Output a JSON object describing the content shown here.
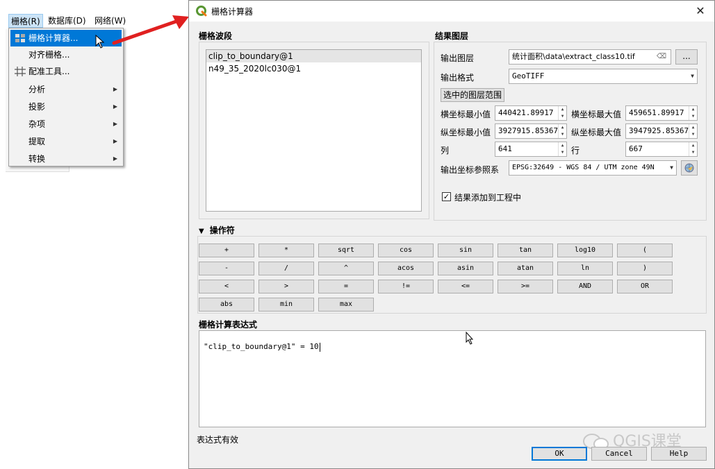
{
  "menubar": {
    "raster": "栅格(R)",
    "database": "数据库(D)",
    "web": "网络(W)"
  },
  "dropdown": {
    "items": [
      {
        "label": "栅格计算器...",
        "submenu": false
      },
      {
        "label": "对齐栅格...",
        "submenu": false
      },
      {
        "label": "配准工具...",
        "submenu": false
      },
      {
        "label": "分析",
        "submenu": true
      },
      {
        "label": "投影",
        "submenu": true
      },
      {
        "label": "杂项",
        "submenu": true
      },
      {
        "label": "提取",
        "submenu": true
      },
      {
        "label": "转换",
        "submenu": true
      }
    ]
  },
  "dialog": {
    "title": "栅格计算器",
    "bands_title": "栅格波段",
    "bands": [
      "clip_to_boundary@1",
      "n49_35_2020lc030@1"
    ],
    "result_title": "结果图层",
    "output_layer_label": "输出图层",
    "output_layer_value": "统计面积\\data\\extract_class10.tif",
    "browse_label": "...",
    "output_format_label": "输出格式",
    "output_format_value": "GeoTIFF",
    "selected_extent_btn": "选中的图层范围",
    "xmin_label": "横坐标最小值",
    "xmin": "440421.89917",
    "xmax_label": "横坐标最大值",
    "xmax": "459651.89917",
    "ymin_label": "纵坐标最小值",
    "ymin": "3927915.85367",
    "ymax_label": "纵坐标最大值",
    "ymax": "3947925.85367",
    "cols_label": "列",
    "cols": "641",
    "rows_label": "行",
    "rows": "667",
    "crs_label": "输出坐标参照系",
    "crs_value": "EPSG:32649 - WGS 84 / UTM zone 49N",
    "add_to_project_label": "结果添加到工程中",
    "operators_title": "操作符",
    "operators": [
      "+",
      "*",
      "sqrt",
      "cos",
      "sin",
      "tan",
      "log10",
      "(",
      "-",
      "/",
      "^",
      "acos",
      "asin",
      "atan",
      "ln",
      ")",
      "<",
      ">",
      "=",
      "!=",
      "<=",
      ">=",
      "AND",
      "OR",
      "abs",
      "min",
      "max"
    ],
    "expression_title": "栅格计算表达式",
    "expression": "\"clip_to_boundary@1\" = 10",
    "status": "表达式有效",
    "ok": "OK",
    "cancel": "Cancel",
    "help": "Help"
  },
  "watermark": "QGIS课堂",
  "colors": {
    "highlight": "#0078d7",
    "qgis_green": "#589632",
    "arrow_red": "#e02020"
  }
}
